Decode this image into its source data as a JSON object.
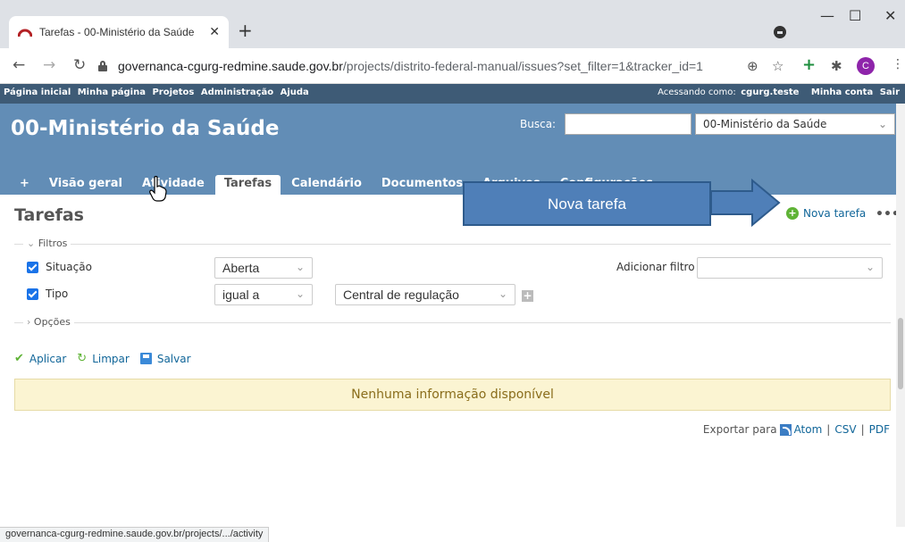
{
  "browser": {
    "tab_title": "Tarefas - 00-Ministério da Saúde",
    "tab_close": "✕",
    "new_tab": "+",
    "url_host": "governanca-cgurg-redmine.saude.gov.br",
    "url_path": "/projects/distrito-federal-manual/issues?set_filter=1&tracker_id=1",
    "avatar_letter": "C",
    "status_url": "governanca-cgurg-redmine.saude.gov.br/projects/.../activity"
  },
  "topmenu": {
    "items": [
      "Página inicial",
      "Minha página",
      "Projetos",
      "Administração",
      "Ajuda"
    ],
    "logged_as_label": "Acessando como:",
    "logged_user": "cgurg.teste",
    "my_account": "Minha conta",
    "logout": "Sair"
  },
  "header": {
    "project_title": "00-Ministério da Saúde",
    "search_label": "Busca:",
    "search_value": "",
    "project_jump": "00-Ministério da Saúde"
  },
  "mainmenu": {
    "items": [
      "+",
      "Visão geral",
      "Atividade",
      "Tarefas",
      "Calendário",
      "Documentos",
      "Arquivos",
      "Configurações"
    ],
    "selected": "Tarefas"
  },
  "content": {
    "title": "Tarefas",
    "new_issue": "Nova tarefa",
    "more": "•••",
    "filters_legend": "Filtros",
    "filters": [
      {
        "label": "Situação",
        "operator": "Aberta",
        "value": ""
      },
      {
        "label": "Tipo",
        "operator": "igual a",
        "value": "Central de regulação"
      }
    ],
    "add_filter_label": "Adicionar filtro",
    "add_filter_value": "",
    "options_legend": "Opções",
    "apply": "Aplicar",
    "clear": "Limpar",
    "save": "Salvar",
    "no_data": "Nenhuma informação disponível",
    "export_label": "Exportar para",
    "export_atom": "Atom",
    "export_csv": "CSV",
    "export_pdf": "PDF",
    "export_sep": "|"
  },
  "annotation": {
    "callout_text": "Nova tarefa"
  }
}
